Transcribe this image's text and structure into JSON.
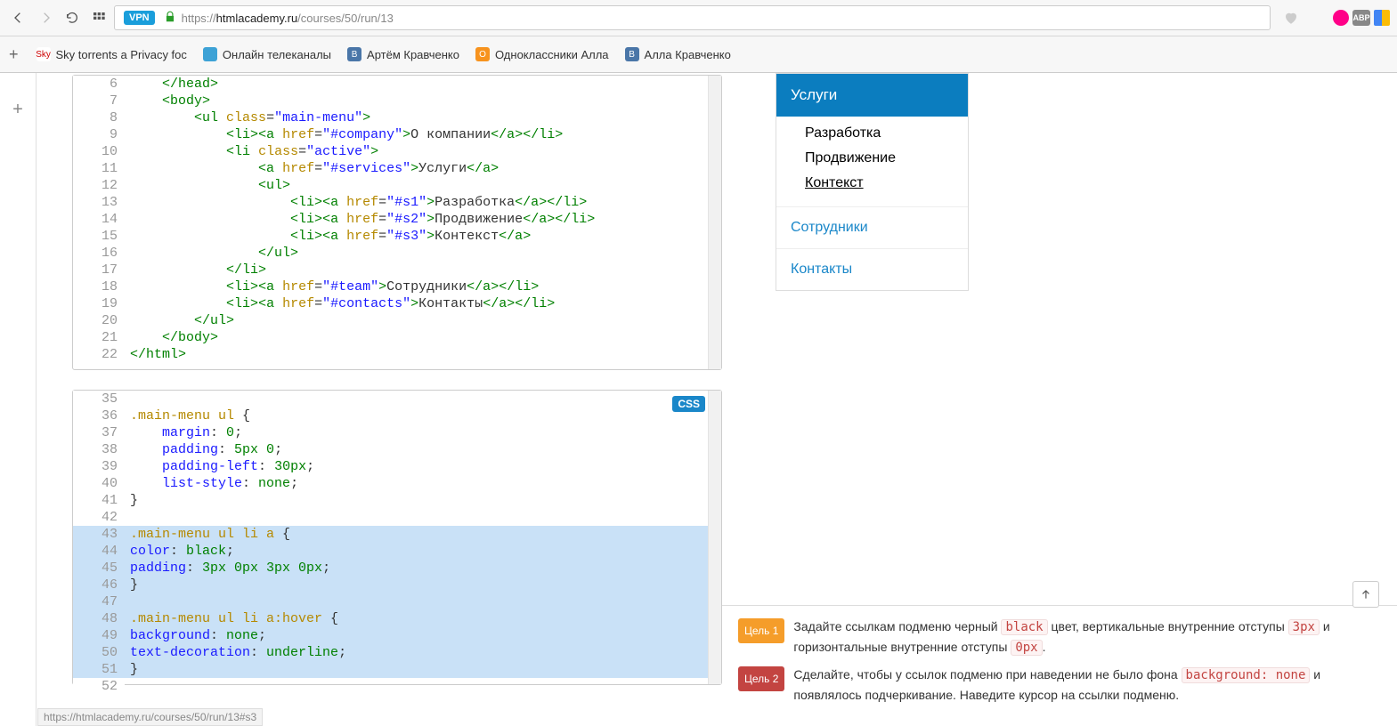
{
  "toolbar": {
    "url_host": "htmlacademy.ru",
    "url_prefix": "https://",
    "url_path": "/courses/50/run/13",
    "vpn": "VPN"
  },
  "bookmarks": [
    {
      "label": "Sky torrents a Privacy foc",
      "icon_bg": "#fff",
      "icon_text": "Sky",
      "icon_color": "#c00"
    },
    {
      "label": "Онлайн телеканалы",
      "icon_bg": "#3da2d6",
      "icon_text": ""
    },
    {
      "label": "Артём Кравченко",
      "icon_bg": "#4a76a8",
      "icon_text": "B"
    },
    {
      "label": "Одноклассники Алла",
      "icon_bg": "#f7931e",
      "icon_text": "O"
    },
    {
      "label": "Алла Кравченко",
      "icon_bg": "#4a76a8",
      "icon_text": "B"
    }
  ],
  "html_code": [
    {
      "n": 6,
      "h": "    </head>"
    },
    {
      "n": 7,
      "h": "    <body>"
    },
    {
      "n": 8,
      "h": "        <ul class=\"main-menu\">"
    },
    {
      "n": 9,
      "h": "            <li><a href=\"#company\">О компании</a></li>"
    },
    {
      "n": 10,
      "h": "            <li class=\"active\">"
    },
    {
      "n": 11,
      "h": "                <a href=\"#services\">Услуги</a>"
    },
    {
      "n": 12,
      "h": "                <ul>"
    },
    {
      "n": 13,
      "h": "                    <li><a href=\"#s1\">Разработка</a></li>"
    },
    {
      "n": 14,
      "h": "                    <li><a href=\"#s2\">Продвижение</a></li>"
    },
    {
      "n": 15,
      "h": "                    <li><a href=\"#s3\">Контекст</a>"
    },
    {
      "n": 16,
      "h": "                </ul>"
    },
    {
      "n": 17,
      "h": "            </li>"
    },
    {
      "n": 18,
      "h": "            <li><a href=\"#team\">Сотрудники</a></li>"
    },
    {
      "n": 19,
      "h": "            <li><a href=\"#contacts\">Контакты</a></li>"
    },
    {
      "n": 20,
      "h": "        </ul>"
    },
    {
      "n": 21,
      "h": "    </body>"
    },
    {
      "n": 22,
      "h": "</html>"
    }
  ],
  "css_code": [
    {
      "n": 35,
      "c": ""
    },
    {
      "n": 36,
      "c": ".main-menu ul {"
    },
    {
      "n": 37,
      "c": "    margin: 0;"
    },
    {
      "n": 38,
      "c": "    padding: 5px 0;"
    },
    {
      "n": 39,
      "c": "    padding-left: 30px;"
    },
    {
      "n": 40,
      "c": "    list-style: none;"
    },
    {
      "n": 41,
      "c": "}"
    },
    {
      "n": 42,
      "c": ""
    },
    {
      "n": 43,
      "c": ".main-menu ul li a {",
      "hl": true
    },
    {
      "n": 44,
      "c": "color: black;",
      "hl": true
    },
    {
      "n": 45,
      "c": "padding: 3px 0px 3px 0px;",
      "hl": true
    },
    {
      "n": 46,
      "c": "}",
      "hl": true
    },
    {
      "n": 47,
      "c": "",
      "hl": true
    },
    {
      "n": 48,
      "c": ".main-menu ul li a:hover {",
      "hl": true
    },
    {
      "n": 49,
      "c": "background: none;",
      "hl": true
    },
    {
      "n": 50,
      "c": "text-decoration: underline;",
      "hl": true
    },
    {
      "n": 51,
      "c": "}",
      "hl": true
    },
    {
      "n": 52,
      "c": ""
    }
  ],
  "css_badge": "CSS",
  "preview": {
    "header": "Услуги",
    "sub": [
      "Разработка",
      "Продвижение",
      "Контекст"
    ],
    "items": [
      "Сотрудники",
      "Контакты"
    ]
  },
  "goals": {
    "g1_label": "Цель 1",
    "g1_a": "Задайте ссылкам подменю черный ",
    "g1_chip1": "black",
    "g1_b": " цвет, вертикальные внутренние отступы ",
    "g1_chip2": "3px",
    "g1_c": " и горизонтальные внутренние отступы ",
    "g1_chip3": "0px",
    "g1_d": ".",
    "g2_label": "Цель 2",
    "g2_a": "Сделайте, чтобы у ссылок подменю при наведении не было фона ",
    "g2_chip1": "background: none",
    "g2_b": " и появлялось подчеркивание. Наведите курсор на ссылки подменю."
  },
  "status": "https://htmlacademy.ru/courses/50/run/13#s3"
}
